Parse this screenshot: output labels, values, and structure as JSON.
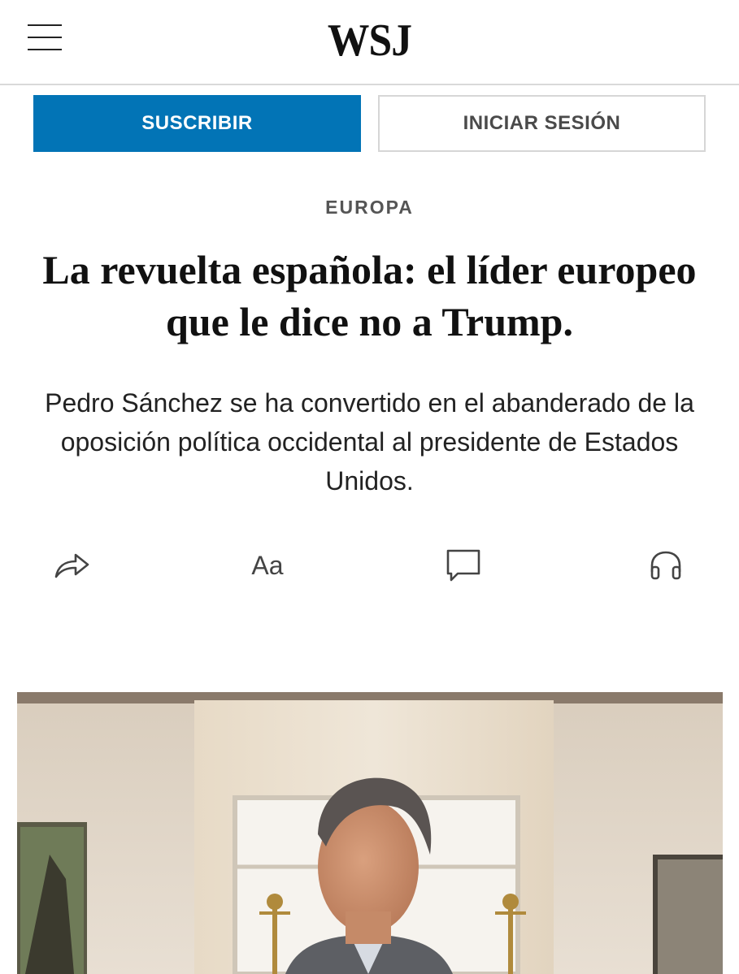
{
  "header": {
    "logo": "WSJ",
    "menu_icon": "hamburger-menu-icon"
  },
  "auth": {
    "subscribe_label": "SUSCRIBIR",
    "login_label": "INICIAR SESIÓN"
  },
  "article": {
    "section": "EUROPA",
    "headline_line1": "La revuelta española: el líder europeo",
    "headline_line2": "que le dice no a Trump.",
    "dek": "Pedro Sánchez se ha convertido en el abanderado de la oposición política occidental al presidente de Estados Unidos."
  },
  "toolbar": {
    "share_icon": "share-icon",
    "text_size_label": "Aa",
    "comments_icon": "comment-icon",
    "listen_icon": "headphones-icon"
  },
  "colors": {
    "accent": "#0274b6",
    "text": "#111111",
    "muted": "#555555",
    "border": "#d6d6d6"
  }
}
